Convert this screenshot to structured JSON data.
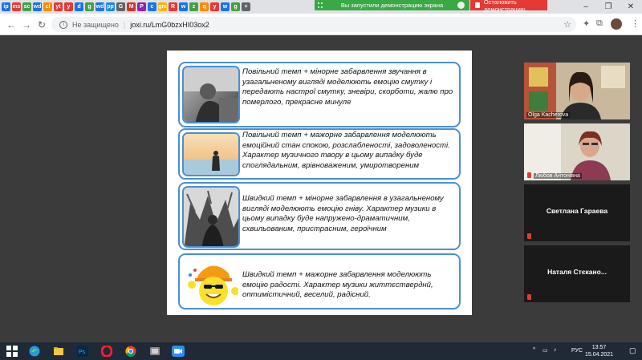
{
  "tabs": {
    "favicons": [
      "ip",
      "ms",
      "sc",
      "wd",
      "cl",
      "yt",
      "y",
      "d",
      "g",
      "wd",
      "pp",
      "G",
      "M",
      "P",
      "c",
      "gm",
      "R",
      "w",
      "z",
      "q",
      "y",
      "w",
      "g",
      "+"
    ],
    "favicon_colors": [
      "#1a73e8",
      "#e53935",
      "#43a047",
      "#1a73e8",
      "#fb8c00",
      "#e53935",
      "#e53935",
      "#1a73e8",
      "#43a047",
      "#1a73e8",
      "#1e88e5",
      "#5f6368",
      "#d93025",
      "#8e24aa",
      "#1a73e8",
      "#f4b400",
      "#e53935",
      "#1a73e8",
      "#43a047",
      "#fb8c00",
      "#e53935",
      "#1a73e8",
      "#43a047",
      "#5f6368"
    ]
  },
  "sharing": {
    "banner_text": "Вы запустили демонстрацию экрана",
    "stop_label": "Остановить демонстрацию"
  },
  "browser": {
    "security": "Не защищено",
    "url": "joxi.ru/LmG0bzxHI03ox2"
  },
  "slide": {
    "cards": [
      {
        "text": "Повільний темп + мінорне забарвлення звучання в узагальненому вигляді моделюють емоцію смутку і передають настрої смутку, зневіри, скорботи, жалю про померлого, прекрасне минуле",
        "image": "sad-person-photo"
      },
      {
        "text": "Повільний темп + мажорне забарвлення моделюють емоційний стан спокою, розслабленості, задоволеності. Характер музичного твору в цьому випадку буде споглядальним, врівноваженим, умиротвореним",
        "image": "calm-seaside-photo"
      },
      {
        "text": "Швидкий темп + мінорне забарвлення в узагальненому вигляді моделюють емоцію гніву. Характер музики в цьому випадку буде напружено-драматичним, схвильованим, пристрасним, героїчним",
        "image": "dramatic-engraving"
      },
      {
        "text": "Швидкий темп + мажорне забарвлення моделюють емоцію радості. Характер музики життєстверднй, оптимістичний, веселий, радісний.",
        "image": "happy-sun-cartoon"
      }
    ]
  },
  "participants": [
    {
      "name": "Olga Kacherova",
      "video": true
    },
    {
      "name": "Любов Антонівна",
      "video": true
    },
    {
      "name": "Светлана Гараева",
      "video": false
    },
    {
      "name": "Наталя Стєкано...",
      "video": false
    }
  ],
  "taskbar": {
    "apps": [
      "windows-start",
      "edge",
      "file-explorer",
      "photoshop",
      "opera",
      "chrome",
      "media",
      "zoom"
    ],
    "lang": "РУС",
    "time": "13:57",
    "date": "15.04.2021"
  }
}
